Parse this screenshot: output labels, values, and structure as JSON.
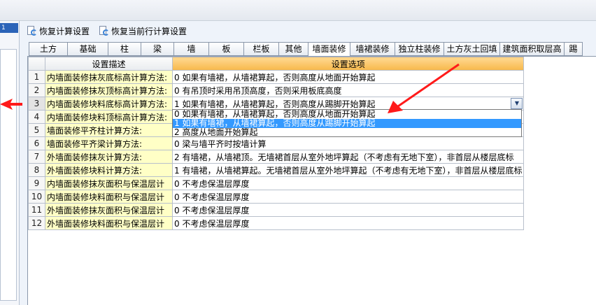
{
  "left_panel": {
    "label": "1"
  },
  "toolbar": {
    "restore_calc_settings": "恢复计算设置",
    "restore_current_row": "恢复当前行计算设置"
  },
  "tabs": [
    {
      "label": "土方",
      "active": false
    },
    {
      "label": "基础",
      "active": false
    },
    {
      "label": "柱",
      "active": false
    },
    {
      "label": "梁",
      "active": false
    },
    {
      "label": "墙",
      "active": false
    },
    {
      "label": "板",
      "active": false
    },
    {
      "label": "栏板",
      "active": false
    },
    {
      "label": "其他",
      "active": false
    },
    {
      "label": "墙面装修",
      "active": true
    },
    {
      "label": "墙裙装修",
      "active": false
    },
    {
      "label": "独立柱装修",
      "active": false
    },
    {
      "label": "土方灰土回填",
      "active": false
    },
    {
      "label": "建筑面积取层高",
      "active": false
    },
    {
      "label": "踢",
      "active": false
    }
  ],
  "grid": {
    "col_desc": "设置描述",
    "col_opt": "设置选项",
    "rows": [
      {
        "num": "1",
        "desc": "内墙面装修抹灰底标高计算方法:",
        "opt": "0 如果有墙裙，从墙裙算起，否则高度从地面开始算起"
      },
      {
        "num": "2",
        "desc": "内墙面装修抹灰顶标高计算方法:",
        "opt": "0 有吊顶时采用吊顶高度，否则采用板底高度"
      },
      {
        "num": "3",
        "desc": "内墙面装修块料底标高计算方法:",
        "opt": "1 如果有墙裙，从墙裙算起，否则高度从踢脚开始算起"
      },
      {
        "num": "4",
        "desc": "内墙面装修块料顶标高计算方法:",
        "opt": ""
      },
      {
        "num": "5",
        "desc": "墙面装修平齐柱计算方法:",
        "opt": ""
      },
      {
        "num": "6",
        "desc": "墙面装修平齐梁计算方法:",
        "opt": "0 梁与墙平齐时按墙计算"
      },
      {
        "num": "7",
        "desc": "外墙面装修抹灰计算方法:",
        "opt": "2 有墙裙，从墙裙顶。无墙裙首层从室外地坪算起（不考虑有无地下室），非首层从楼层底标"
      },
      {
        "num": "8",
        "desc": "外墙面装修块料计算方法:",
        "opt": "1 有墙裙，从墙裙算起。无墙裙首层从室外地坪算起（不考虑有无地下室），非首层从楼层底标"
      },
      {
        "num": "9",
        "desc": "内墙面装修抹灰面积与保温层计",
        "opt": "0 不考虑保温层厚度"
      },
      {
        "num": "10",
        "desc": "内墙面装修块料面积与保温层计",
        "opt": "0 不考虑保温层厚度"
      },
      {
        "num": "11",
        "desc": "外墙面装修抹灰面积与保温层计",
        "opt": "0 不考虑保温层厚度"
      },
      {
        "num": "12",
        "desc": "外墙面装修块料面积与保温层计",
        "opt": "0 不考虑保温层厚度"
      }
    ]
  },
  "dropdown": {
    "options": [
      "0 如果有墙裙，从墙裙算起，否则高度从地面开始算起",
      "1 如果有墙裙，从墙裙算起，否则高度从踢脚开始算起",
      "2 高度从地面开始算起"
    ],
    "highlighted": 1
  },
  "colors": {
    "annotation_red": "#ff1a1a",
    "header_orange": "#f7b84b",
    "desc_yellow": "#ffffc6",
    "highlight_blue": "#3399ff"
  }
}
